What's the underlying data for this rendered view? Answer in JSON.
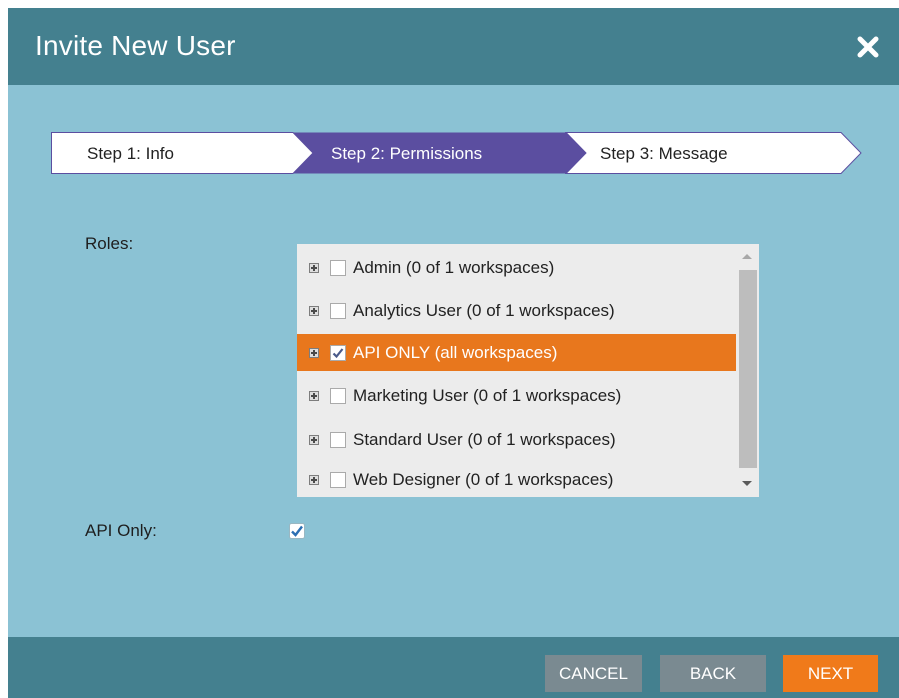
{
  "dialog": {
    "title": "Invite New User",
    "close_icon": "close-icon"
  },
  "steps": [
    {
      "label": "Step 1: Info",
      "state": "done"
    },
    {
      "label": "Step 2: Permissions",
      "state": "active"
    },
    {
      "label": "Step 3: Message",
      "state": "upcoming"
    }
  ],
  "roles": {
    "label": "Roles:",
    "items": [
      {
        "label": "Admin (0 of 1 workspaces)",
        "checked": false,
        "selected": false
      },
      {
        "label": "Analytics User (0 of 1 workspaces)",
        "checked": false,
        "selected": false
      },
      {
        "label": "API ONLY (all workspaces)",
        "checked": true,
        "selected": true
      },
      {
        "label": "Marketing User (0 of 1 workspaces)",
        "checked": false,
        "selected": false
      },
      {
        "label": "Standard User (0 of 1 workspaces)",
        "checked": false,
        "selected": false
      },
      {
        "label": "Web Designer (0 of 1 workspaces)",
        "checked": false,
        "selected": false
      }
    ]
  },
  "api_only": {
    "label": "API Only:",
    "checked": true
  },
  "footer": {
    "cancel": "CANCEL",
    "back": "BACK",
    "next": "NEXT"
  },
  "colors": {
    "header": "#44808f",
    "body": "#8bc2d4",
    "active_step": "#5b4ea0",
    "selected_row": "#e8771d",
    "next_button": "#f07a1a",
    "secondary_button": "#7a8a91"
  }
}
